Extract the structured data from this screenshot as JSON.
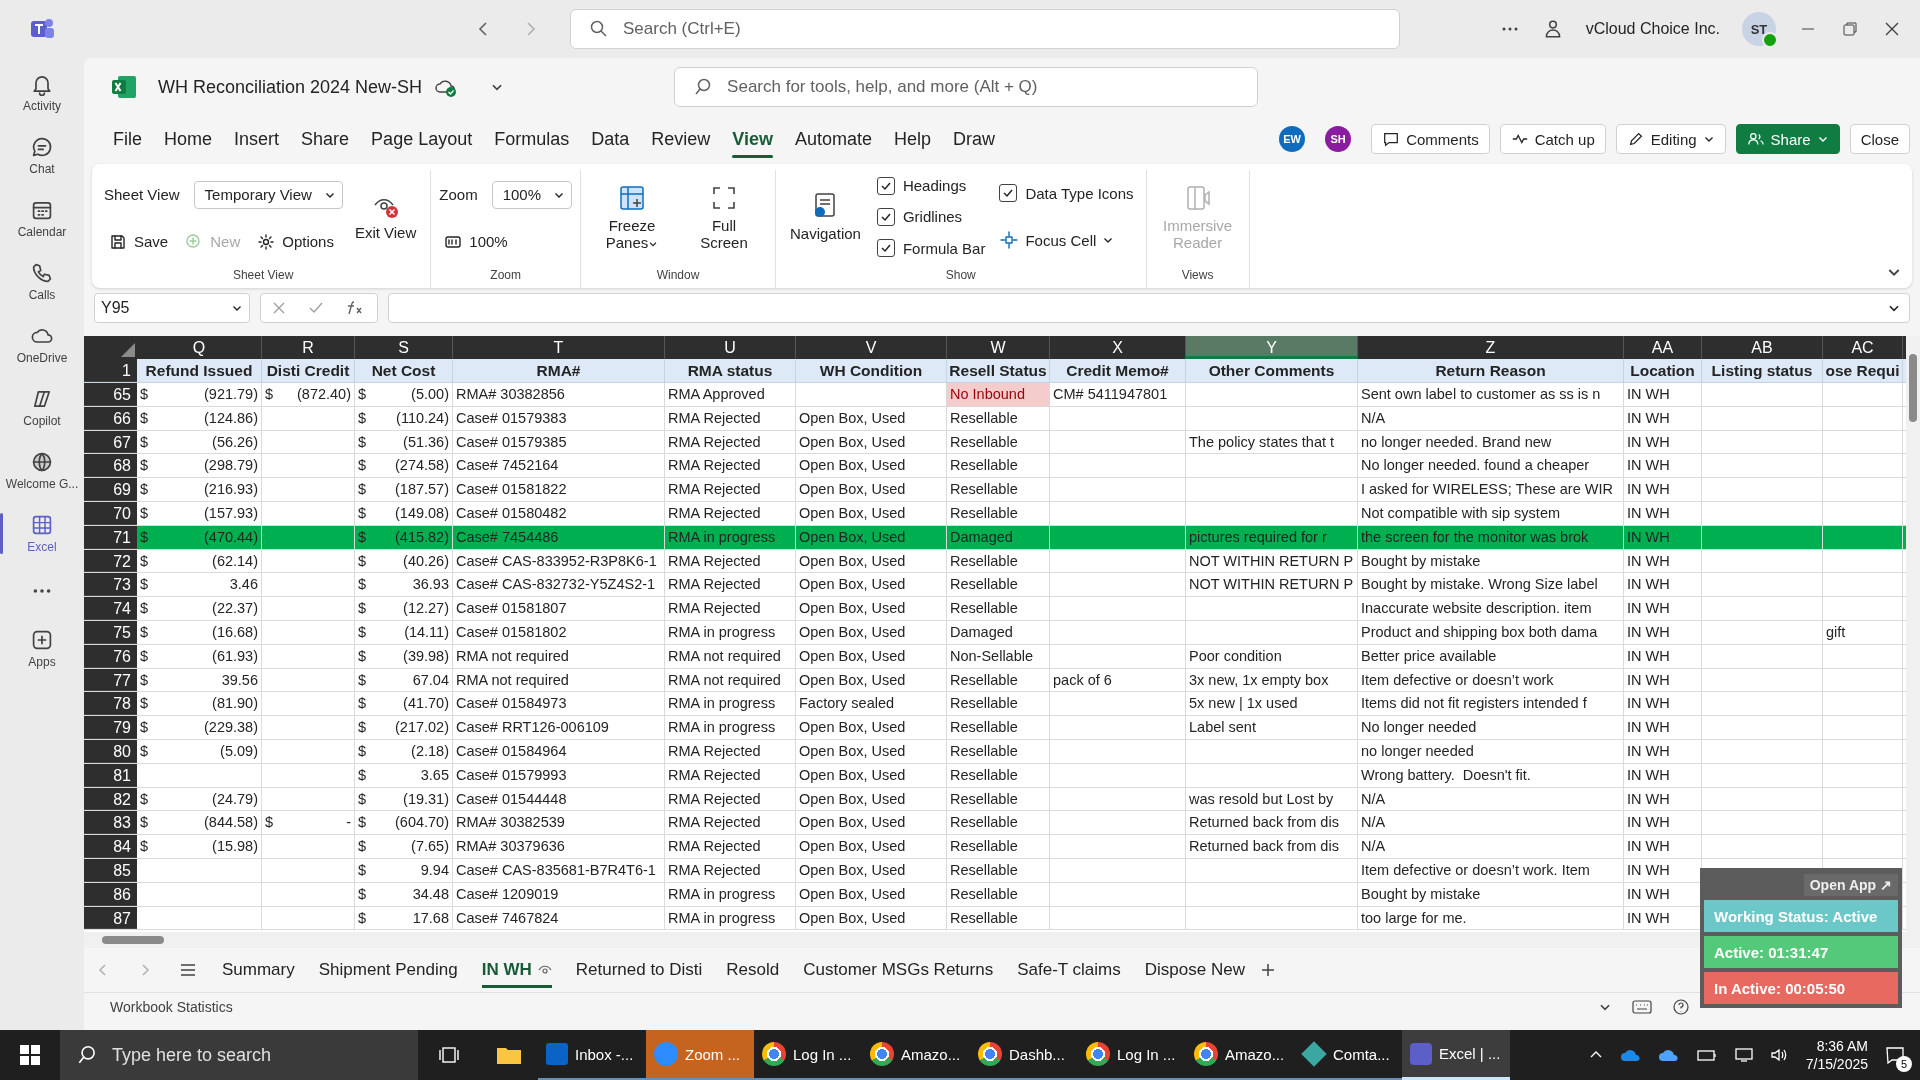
{
  "teams": {
    "search": {
      "placeholder": "Search (Ctrl+E)"
    },
    "org": "vCloud Choice Inc.",
    "avatar": "ST",
    "rail": [
      {
        "label": "Activity",
        "selected": false
      },
      {
        "label": "Chat",
        "selected": false
      },
      {
        "label": "Calendar",
        "selected": false
      },
      {
        "label": "Calls",
        "selected": false
      },
      {
        "label": "OneDrive",
        "selected": false
      },
      {
        "label": "Copilot",
        "selected": false
      },
      {
        "label": "Welcome G...",
        "selected": false
      },
      {
        "label": "Excel",
        "selected": true
      },
      {
        "label": "Apps",
        "selected": false
      }
    ]
  },
  "workbook": {
    "title": "WH Reconciliation 2024 New-SH",
    "search": {
      "placeholder": "Search for tools, help, and more (Alt + Q)"
    }
  },
  "menu": [
    {
      "label": "File",
      "selected": false
    },
    {
      "label": "Home",
      "selected": false
    },
    {
      "label": "Insert",
      "selected": false
    },
    {
      "label": "Share",
      "selected": false
    },
    {
      "label": "Page Layout",
      "selected": false
    },
    {
      "label": "Formulas",
      "selected": false
    },
    {
      "label": "Data",
      "selected": false
    },
    {
      "label": "Review",
      "selected": false
    },
    {
      "label": "View",
      "selected": true
    },
    {
      "label": "Automate",
      "selected": false
    },
    {
      "label": "Help",
      "selected": false
    },
    {
      "label": "Draw",
      "selected": false
    }
  ],
  "collaborators": [
    {
      "initials": "EW",
      "color": "#0f6cbd"
    },
    {
      "initials": "SH",
      "color": "#8a1c9f"
    }
  ],
  "actions": [
    {
      "label": "Comments",
      "kind": "plain"
    },
    {
      "label": "Catch up",
      "kind": "plain"
    },
    {
      "label": "Editing",
      "kind": "menu"
    },
    {
      "label": "Share",
      "kind": "primary"
    },
    {
      "label": "Close",
      "kind": "plain"
    }
  ],
  "ribbon": [
    {
      "label": "Sheet View",
      "columns": [
        [
          [
            {
              "kind": "dropdown",
              "label": "Sheet View",
              "value": "Temporary View"
            }
          ],
          [
            {
              "kind": "button",
              "label": "Save",
              "disabled": false
            },
            {
              "kind": "button",
              "label": "New",
              "disabled": true
            },
            {
              "kind": "button",
              "label": "Options",
              "disabled": false
            }
          ]
        ],
        [
          [
            {
              "kind": "large",
              "label": "Exit View",
              "disabled": false
            }
          ]
        ]
      ]
    },
    {
      "label": "Zoom",
      "columns": [
        [
          [
            {
              "kind": "dropdown",
              "label": "Zoom",
              "value": "100%"
            }
          ],
          [
            {
              "kind": "button",
              "label": "100%",
              "disabled": false
            }
          ]
        ]
      ]
    },
    {
      "label": "Window",
      "columns": [
        [
          [
            {
              "kind": "large_menu",
              "label": "Freeze Panes",
              "disabled": false
            }
          ]
        ],
        [
          [
            {
              "kind": "large",
              "label": "Full Screen",
              "disabled": false
            }
          ]
        ]
      ]
    },
    {
      "label": "Show",
      "columns": [
        [
          [
            {
              "kind": "large",
              "label": "Navigation",
              "disabled": false
            }
          ]
        ],
        [
          [
            {
              "kind": "checkbox",
              "label": "Headings",
              "checked": true
            }
          ],
          [
            {
              "kind": "checkbox",
              "label": "Gridlines",
              "checked": true
            }
          ],
          [
            {
              "kind": "checkbox",
              "label": "Formula Bar",
              "checked": true
            }
          ]
        ],
        [
          [
            {
              "kind": "checkbox",
              "label": "Data Type Icons",
              "checked": true
            }
          ],
          [
            {
              "kind": "button_menu",
              "label": "Focus Cell",
              "disabled": false
            }
          ]
        ]
      ]
    },
    {
      "label": "Views",
      "columns": [
        [
          [
            {
              "kind": "large",
              "label": "Immersive Reader",
              "disabled": true
            }
          ]
        ]
      ]
    }
  ],
  "formula_bar": {
    "name_box": "Y95"
  },
  "sheet": {
    "columns": [
      {
        "letter": "Q",
        "header": "Refund Issued",
        "selected": false
      },
      {
        "letter": "R",
        "header": "Disti Credit",
        "selected": false
      },
      {
        "letter": "S",
        "header": "Net Cost",
        "selected": false
      },
      {
        "letter": "T",
        "header": "RMA#",
        "selected": false
      },
      {
        "letter": "U",
        "header": "RMA status",
        "selected": false
      },
      {
        "letter": "V",
        "header": "WH Condition",
        "selected": false
      },
      {
        "letter": "W",
        "header": "Resell Status",
        "selected": false
      },
      {
        "letter": "X",
        "header": "Credit Memo#",
        "selected": false
      },
      {
        "letter": "Y",
        "header": "Other Comments",
        "selected": true
      },
      {
        "letter": "Z",
        "header": "Return Reason",
        "selected": false
      },
      {
        "letter": "AA",
        "header": "Location",
        "selected": false
      },
      {
        "letter": "AB",
        "header": "Listing status",
        "selected": false
      },
      {
        "letter": "AC",
        "header": "ose Requi",
        "selected": false
      }
    ],
    "header_row": "1",
    "rows": [
      {
        "num": "65",
        "highlighted": false,
        "flagged": true,
        "q": [
          "$",
          "(921.79)"
        ],
        "r": [
          "$",
          "(872.40)"
        ],
        "s": [
          "$",
          "(5.00)"
        ],
        "t": "RMA# 30382856",
        "u": "RMA Approved",
        "w": "No Inbound",
        "x": "CM# 5411947801",
        "z": "Sent own label to customer as ss is n",
        "aa": "IN WH"
      },
      {
        "num": "66",
        "highlighted": false,
        "flagged": false,
        "q": [
          "$",
          "(124.86)"
        ],
        "s": [
          "$",
          "(110.24)"
        ],
        "t": "Case# 01579383",
        "u": "RMA Rejected",
        "v": "Open Box, Used",
        "w": "Resellable",
        "z": "N/A",
        "aa": "IN WH"
      },
      {
        "num": "67",
        "highlighted": false,
        "flagged": false,
        "q": [
          "$",
          "(56.26)"
        ],
        "s": [
          "$",
          "(51.36)"
        ],
        "t": "Case# 01579385",
        "u": "RMA Rejected",
        "v": "Open Box, Used",
        "w": "Resellable",
        "y": "The policy states that t",
        "z": "no longer needed. Brand new",
        "aa": "IN WH"
      },
      {
        "num": "68",
        "highlighted": false,
        "flagged": false,
        "q": [
          "$",
          "(298.79)"
        ],
        "s": [
          "$",
          "(274.58)"
        ],
        "t": "Case# 7452164",
        "u": "RMA Rejected",
        "v": "Open Box, Used",
        "w": "Resellable",
        "z": "No longer needed. found a cheaper",
        "aa": "IN WH"
      },
      {
        "num": "69",
        "highlighted": false,
        "flagged": false,
        "q": [
          "$",
          "(216.93)"
        ],
        "s": [
          "$",
          "(187.57)"
        ],
        "t": "Case# 01581822",
        "u": "RMA Rejected",
        "v": "Open Box, Used",
        "w": "Resellable",
        "z": "I asked for WIRELESS; These are WIR",
        "aa": "IN WH"
      },
      {
        "num": "70",
        "highlighted": false,
        "flagged": false,
        "q": [
          "$",
          "(157.93)"
        ],
        "s": [
          "$",
          "(149.08)"
        ],
        "t": "Case# 01580482",
        "u": "RMA Rejected",
        "v": "Open Box, Used",
        "w": "Resellable",
        "z": "Not compatible with sip system",
        "aa": "IN WH"
      },
      {
        "num": "71",
        "highlighted": true,
        "flagged": false,
        "q": [
          "$",
          "(470.44)"
        ],
        "s": [
          "$",
          "(415.82)"
        ],
        "t": "Case# 7454486",
        "u": "RMA in progress",
        "v": "Open Box, Used",
        "w": "Damaged",
        "y": "pictures required for r",
        "z": "the screen for the monitor was brok",
        "aa": "IN WH"
      },
      {
        "num": "72",
        "highlighted": false,
        "flagged": false,
        "q": [
          "$",
          "(62.14)"
        ],
        "s": [
          "$",
          "(40.26)"
        ],
        "t": "Case# CAS-833952-R3P8K6-1",
        "u": "RMA Rejected",
        "v": "Open Box, Used",
        "w": "Resellable",
        "y": "NOT WITHIN RETURN P",
        "z": "Bought by mistake",
        "aa": "IN WH"
      },
      {
        "num": "73",
        "highlighted": false,
        "flagged": false,
        "q": [
          "$",
          "3.46"
        ],
        "s": [
          "$",
          "36.93"
        ],
        "t": "Case# CAS-832732-Y5Z4S2-1",
        "u": "RMA Rejected",
        "v": "Open Box, Used",
        "w": "Resellable",
        "y": "NOT WITHIN RETURN P",
        "z": "Bought by mistake. Wrong Size label",
        "aa": "IN WH"
      },
      {
        "num": "74",
        "highlighted": false,
        "flagged": false,
        "q": [
          "$",
          "(22.37)"
        ],
        "s": [
          "$",
          "(12.27)"
        ],
        "t": "Case# 01581807",
        "u": "RMA Rejected",
        "v": "Open Box, Used",
        "w": "Resellable",
        "z": "Inaccurate website description. item",
        "aa": "IN WH"
      },
      {
        "num": "75",
        "highlighted": false,
        "flagged": false,
        "q": [
          "$",
          "(16.68)"
        ],
        "s": [
          "$",
          "(14.11)"
        ],
        "t": "Case# 01581802",
        "u": "RMA in progress",
        "v": "Open Box, Used",
        "w": "Damaged",
        "z": "Product and shipping box both dama",
        "aa": "IN WH",
        "ac": "gift"
      },
      {
        "num": "76",
        "highlighted": false,
        "flagged": false,
        "q": [
          "$",
          "(61.93)"
        ],
        "s": [
          "$",
          "(39.98)"
        ],
        "t": "RMA not required",
        "u": "RMA not required",
        "v": "Open Box, Used",
        "w": "Non-Sellable",
        "y": "Poor condition",
        "z": "Better price available",
        "aa": "IN WH"
      },
      {
        "num": "77",
        "highlighted": false,
        "flagged": false,
        "q": [
          "$",
          "39.56"
        ],
        "s": [
          "$",
          "67.04"
        ],
        "t": "RMA not required",
        "u": "RMA not required",
        "v": "Open Box, Used",
        "w": "Resellable",
        "x": "pack of 6",
        "y": "3x new, 1x empty box",
        "z": "Item defective or doesn’t work",
        "aa": "IN WH"
      },
      {
        "num": "78",
        "highlighted": false,
        "flagged": false,
        "q": [
          "$",
          "(81.90)"
        ],
        "s": [
          "$",
          "(41.70)"
        ],
        "t": "Case# 01584973",
        "u": "RMA in progress",
        "v": "Factory sealed",
        "w": "Resellable",
        "y": "5x new | 1x used",
        "z": "Items did not fit registers intended f",
        "aa": "IN WH"
      },
      {
        "num": "79",
        "highlighted": false,
        "flagged": false,
        "q": [
          "$",
          "(229.38)"
        ],
        "s": [
          "$",
          "(217.02)"
        ],
        "t": "Case# RRT126-006109",
        "u": "RMA in progress",
        "v": "Open Box, Used",
        "w": "Resellable",
        "y": "Label sent",
        "z": "No longer needed",
        "aa": "IN WH"
      },
      {
        "num": "80",
        "highlighted": false,
        "flagged": false,
        "q": [
          "$",
          "(5.09)"
        ],
        "s": [
          "$",
          "(2.18)"
        ],
        "t": "Case# 01584964",
        "u": "RMA Rejected",
        "v": "Open Box, Used",
        "w": "Resellable",
        "z": "no longer needed",
        "aa": "IN WH"
      },
      {
        "num": "81",
        "highlighted": false,
        "flagged": false,
        "s": [
          "$",
          "3.65"
        ],
        "t": "Case# 01579993",
        "u": "RMA Rejected",
        "v": "Open Box, Used",
        "w": "Resellable",
        "z": "Wrong battery.  Doesn't fit.",
        "aa": "IN WH"
      },
      {
        "num": "82",
        "highlighted": false,
        "flagged": false,
        "q": [
          "$",
          "(24.79)"
        ],
        "s": [
          "$",
          "(19.31)"
        ],
        "t": "Case# 01544448",
        "u": "RMA Rejected",
        "v": "Open Box, Used",
        "w": "Resellable",
        "y": "was resold but Lost by",
        "z": "N/A",
        "aa": "IN WH"
      },
      {
        "num": "83",
        "highlighted": false,
        "flagged": false,
        "q": [
          "$",
          "(844.58)"
        ],
        "r": [
          "$",
          "-"
        ],
        "s": [
          "$",
          "(604.70)"
        ],
        "t": "RMA# 30382539",
        "u": "RMA Rejected",
        "v": "Open Box, Used",
        "w": "Resellable",
        "y": "Returned back from dis",
        "z": "N/A",
        "aa": "IN WH"
      },
      {
        "num": "84",
        "highlighted": false,
        "flagged": false,
        "q": [
          "$",
          "(15.98)"
        ],
        "s": [
          "$",
          "(7.65)"
        ],
        "t": "RMA# 30379636",
        "u": "RMA Rejected",
        "v": "Open Box, Used",
        "w": "Resellable",
        "y": "Returned back from dis",
        "z": "N/A",
        "aa": "IN WH"
      },
      {
        "num": "85",
        "highlighted": false,
        "flagged": false,
        "s": [
          "$",
          "9.94"
        ],
        "t": "Case# CAS-835681-B7R4T6-1",
        "u": "RMA Rejected",
        "v": "Open Box, Used",
        "w": "Resellable",
        "z": "Item defective or doesn’t work. Item",
        "aa": "IN WH"
      },
      {
        "num": "86",
        "highlighted": false,
        "flagged": false,
        "s": [
          "$",
          "34.48"
        ],
        "t": "Case# 1209019",
        "u": "RMA in progress",
        "v": "Open Box, Used",
        "w": "Resellable",
        "z": "Bought by mistake",
        "aa": "IN WH"
      },
      {
        "num": "87",
        "highlighted": false,
        "flagged": false,
        "s": [
          "$",
          "17.68"
        ],
        "t": "Case# 7467824",
        "u": "RMA in progress",
        "v": "Open Box, Used",
        "w": "Resellable",
        "z": "too large for me.",
        "aa": "IN WH"
      }
    ]
  },
  "sheet_tabs": [
    {
      "label": "Summary",
      "selected": false
    },
    {
      "label": "Shipment Pending",
      "selected": false
    },
    {
      "label": "IN WH",
      "selected": true
    },
    {
      "label": "Returned to Disti",
      "selected": false
    },
    {
      "label": "Resold",
      "selected": false
    },
    {
      "label": "Customer MSGs Returns",
      "selected": false
    },
    {
      "label": "Safe-T claims",
      "selected": false
    },
    {
      "label": "Dispose New",
      "selected": false
    }
  ],
  "status_bar": {
    "left": "Workbook Statistics"
  },
  "tracker": {
    "button": "Open App ↗",
    "status": "Working Status: Active",
    "active": "Active: 01:31:47",
    "inactive": "In Active: 00:05:50"
  },
  "taskbar": {
    "search": {
      "placeholder": "Type here to search"
    },
    "apps": [
      {
        "label": "Inbox -...",
        "selected": false,
        "attention": false
      },
      {
        "label": "Zoom ...",
        "selected": false,
        "attention": true
      },
      {
        "label": "Log In ...",
        "selected": false,
        "attention": false
      },
      {
        "label": "Amazo...",
        "selected": false,
        "attention": false
      },
      {
        "label": "Dashb...",
        "selected": false,
        "attention": false
      },
      {
        "label": "Log In ...",
        "selected": false,
        "attention": false
      },
      {
        "label": "Amazo...",
        "selected": false,
        "attention": false
      },
      {
        "label": "Comta...",
        "selected": false,
        "attention": false
      },
      {
        "label": "Excel | ...",
        "selected": true,
        "attention": false
      }
    ],
    "time": "8:36 AM",
    "date": "7/15/2025",
    "notifications": "5"
  }
}
